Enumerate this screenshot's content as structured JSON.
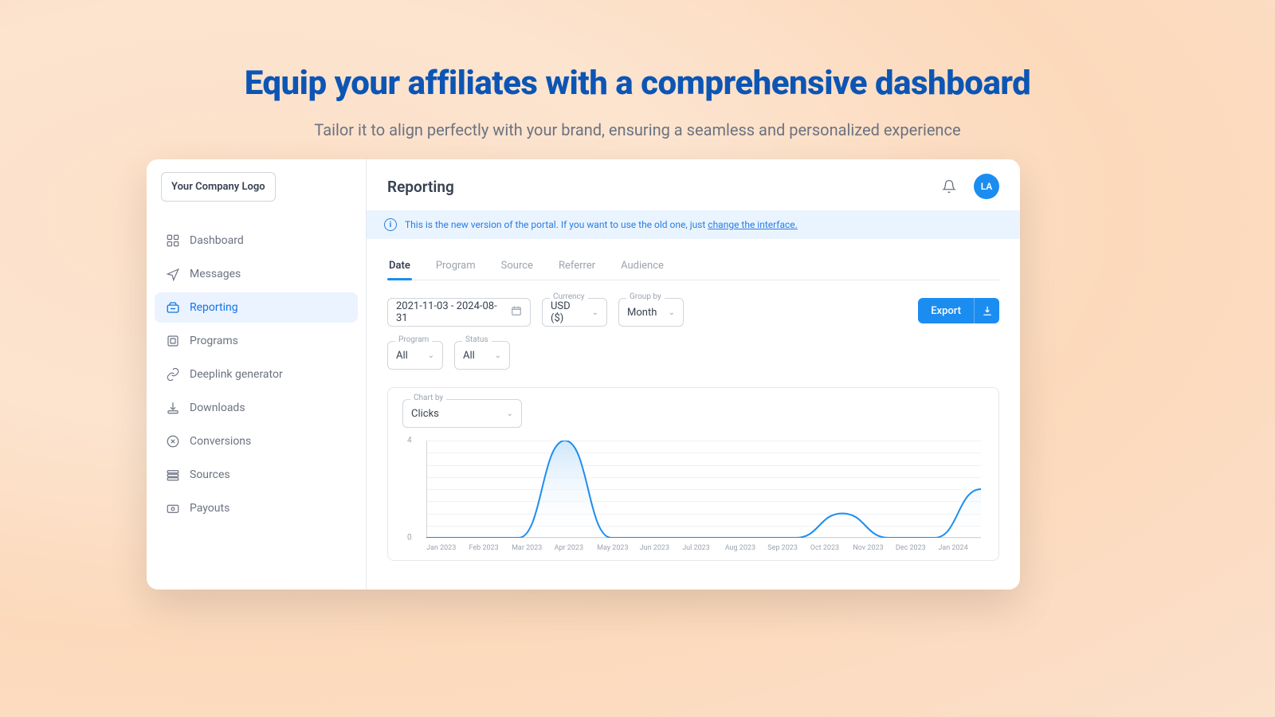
{
  "hero": {
    "title": "Equip your affiliates with  a comprehensive dashboard",
    "subtitle": "Tailor it to align perfectly with your brand, ensuring a seamless and personalized experience"
  },
  "logo": {
    "text": "Your Company Logo"
  },
  "sidebar": {
    "items": [
      {
        "label": "Dashboard",
        "icon": "dashboard"
      },
      {
        "label": "Messages",
        "icon": "messages"
      },
      {
        "label": "Reporting",
        "icon": "reporting",
        "active": true
      },
      {
        "label": "Programs",
        "icon": "programs"
      },
      {
        "label": "Deeplink generator",
        "icon": "deeplink"
      },
      {
        "label": "Downloads",
        "icon": "downloads"
      },
      {
        "label": "Conversions",
        "icon": "conversions"
      },
      {
        "label": "Sources",
        "icon": "sources"
      },
      {
        "label": "Payouts",
        "icon": "payouts"
      }
    ]
  },
  "header": {
    "title": "Reporting",
    "avatar": "LA"
  },
  "banner": {
    "text": "This is the new version of the portal. If you want to use the old one, just ",
    "link": "change the interface."
  },
  "tabs": [
    "Date",
    "Program",
    "Source",
    "Referrer",
    "Audience"
  ],
  "active_tab": 0,
  "filters": {
    "date_range": "2021-11-03 - 2024-08-31",
    "currency_label": "Currency",
    "currency": "USD ($)",
    "groupby_label": "Group by",
    "groupby": "Month",
    "program_label": "Program",
    "program": "All",
    "status_label": "Status",
    "status": "All",
    "export": "Export",
    "chartby_label": "Chart by",
    "chartby": "Clicks"
  },
  "chart_data": {
    "type": "line",
    "title": "",
    "xlabel": "",
    "ylabel": "",
    "ylim": [
      0,
      4
    ],
    "y_ticks": [
      0,
      4
    ],
    "categories": [
      "Jan 2023",
      "Feb 2023",
      "Mar 2023",
      "Apr 2023",
      "May 2023",
      "Jun 2023",
      "Jul 2023",
      "Aug 2023",
      "Sep 2023",
      "Oct 2023",
      "Nov 2023",
      "Dec 2023",
      "Jan 2024"
    ],
    "series": [
      {
        "name": "Clicks",
        "values": [
          0,
          0,
          0,
          4,
          0,
          0,
          0,
          0,
          0,
          1,
          0,
          0,
          2
        ]
      }
    ]
  }
}
